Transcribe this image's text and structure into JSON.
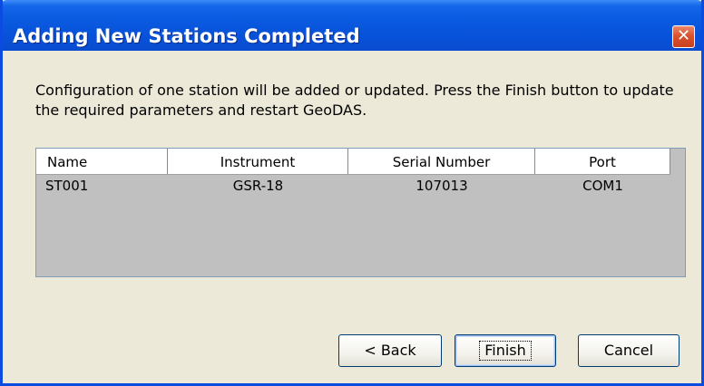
{
  "window": {
    "title": "Adding New Stations Completed",
    "close_glyph": "✕"
  },
  "message": "Configuration of one station will be added or updated. Press the Finish button to update the required parameters and restart GeoDAS.",
  "table": {
    "columns": [
      "Name",
      "Instrument",
      "Serial Number",
      "Port"
    ],
    "rows": [
      [
        "ST001",
        "GSR-18",
        "107013",
        "COM1"
      ]
    ]
  },
  "buttons": {
    "back": "< Back",
    "finish": "Finish",
    "cancel": "Cancel"
  },
  "colors": {
    "title_bar": "#0a5ae0",
    "dialog_bg": "#ece9d8",
    "list_bg": "#c0c0c0",
    "close_button": "#d9532f"
  }
}
